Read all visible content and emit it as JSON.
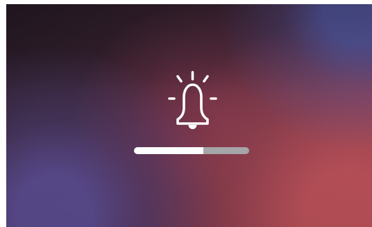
{
  "screen": {
    "background_colors": {
      "top_left": "#261A25",
      "center": "#4E283B",
      "bottom_right": "#BF535B",
      "top_right_glow": "#4F58A3",
      "bottom_left_glow": "#5D4E96"
    },
    "icon": "bell-ringing-icon",
    "icon_color": "#FFFFFF",
    "volume": {
      "level": 0.6,
      "track_color": "#A6A5A8",
      "fill_color": "#FFFFFF"
    }
  }
}
